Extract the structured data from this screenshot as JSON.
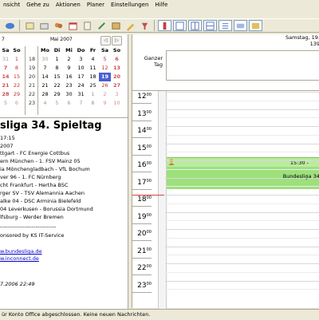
{
  "menubar": [
    "nsicht",
    "Gehe zu",
    "Aktionen",
    "Planer",
    "Einstellungen",
    "Hilfe"
  ],
  "calendar": {
    "left_header": "7",
    "right_header": "Mai 2007",
    "left_days": [
      "Sa",
      "So"
    ],
    "right_days": [
      "Mo",
      "Di",
      "Mi",
      "Do",
      "Fr",
      "Sa",
      "So"
    ],
    "left_rows": [
      [
        "31",
        "1"
      ],
      [
        "7",
        "8"
      ],
      [
        "14",
        "15"
      ],
      [
        "21",
        "22"
      ],
      [
        "28",
        "29"
      ],
      [
        "5",
        "6"
      ]
    ],
    "weeks": [
      "18",
      "19",
      "20",
      "21",
      "22",
      "23"
    ],
    "right_rows": [
      [
        "30",
        "1",
        "2",
        "3",
        "4",
        "5",
        "6"
      ],
      [
        "7",
        "8",
        "9",
        "10",
        "11",
        "12",
        "13"
      ],
      [
        "14",
        "15",
        "16",
        "17",
        "18",
        "19",
        "20"
      ],
      [
        "21",
        "22",
        "23",
        "24",
        "25",
        "26",
        "27"
      ],
      [
        "28",
        "29",
        "30",
        "31",
        "1",
        "2",
        "3"
      ],
      [
        "4",
        "5",
        "6",
        "7",
        "8",
        "9",
        "10"
      ]
    ]
  },
  "info": {
    "title": "sliga 34. Spieltag",
    "time": "17:15",
    "year": "2007",
    "matches": [
      "ttgart - FC Energie Cottbus",
      "ern München - 1. FSV Mainz 05",
      "ia Mönchengladbach - VfL Bochum",
      "ver 96 - 1. FC Nürnberg",
      "cht Frankfurt - Hertha BSC",
      "rger SV - TSV Alemannia Aachen",
      "alke 04 - DSC Arminia Bielefeld",
      "04 Leverkusen - Borussia Dortmund",
      "lfsburg - Werder Bremen"
    ],
    "separator": "------------------------------",
    "sponsor": "onsored by KS IT-Service",
    "link1": "w.bundesliga.de",
    "link2": "w.inconnect.de",
    "footer": "7.2006 22:49"
  },
  "dayview": {
    "date": "Samstag, 19.",
    "week": "139",
    "allday_label": "Ganzer Tag",
    "hours": [
      "12",
      "13",
      "14",
      "15",
      "16",
      "17",
      "18",
      "19",
      "20",
      "21",
      "22",
      "23"
    ],
    "event_time": "15:30 -",
    "event_title": "Bundesliga 34"
  },
  "status": "ür Konto Office abgeschlossen. Keine neuen Nachrichten."
}
